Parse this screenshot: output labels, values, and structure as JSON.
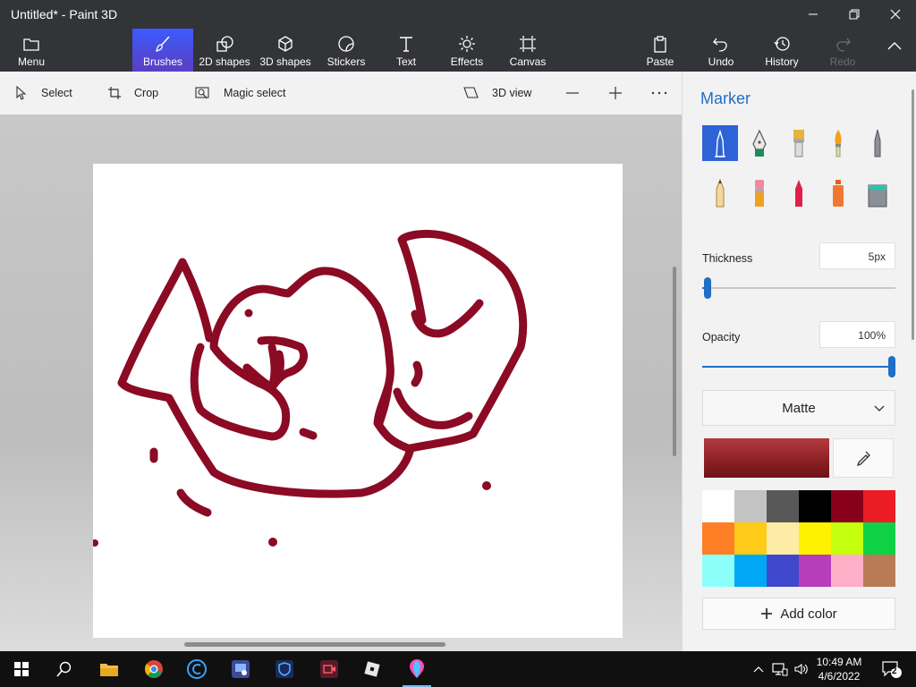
{
  "window": {
    "title": "Untitled* - Paint 3D"
  },
  "ribbon": {
    "menu": "Menu",
    "brushes": "Brushes",
    "shapes2d": "2D shapes",
    "shapes3d": "3D shapes",
    "stickers": "Stickers",
    "text": "Text",
    "effects": "Effects",
    "canvas": "Canvas",
    "paste": "Paste",
    "undo": "Undo",
    "history": "History",
    "redo": "Redo"
  },
  "toolbar": {
    "select": "Select",
    "crop": "Crop",
    "magic_select": "Magic select",
    "view3d": "3D view"
  },
  "panel": {
    "title": "Marker",
    "thickness_label": "Thickness",
    "thickness_value": "5px",
    "thickness_level": 0.03,
    "opacity_label": "Opacity",
    "opacity_value": "100%",
    "opacity_level": 1.0,
    "finish": "Matte",
    "add_color": "Add color",
    "current_color": "#8b1e24",
    "palette": [
      "#ffffff",
      "#c3c3c3",
      "#585858",
      "#000000",
      "#88001b",
      "#ec1c24",
      "#ff7f27",
      "#ffca18",
      "#fdeca6",
      "#fff200",
      "#c4ff0e",
      "#0ed145",
      "#8cfffb",
      "#00a8f3",
      "#3f48cc",
      "#b83dba",
      "#ffaec8",
      "#b97a56"
    ]
  },
  "taskbar": {
    "time": "10:49 AM",
    "date": "4/6/2022",
    "notifications": "2"
  },
  "colors": {
    "accent": "#1f6fc6",
    "stroke": "#8b0a24",
    "ribbon_bg": "#333438"
  }
}
